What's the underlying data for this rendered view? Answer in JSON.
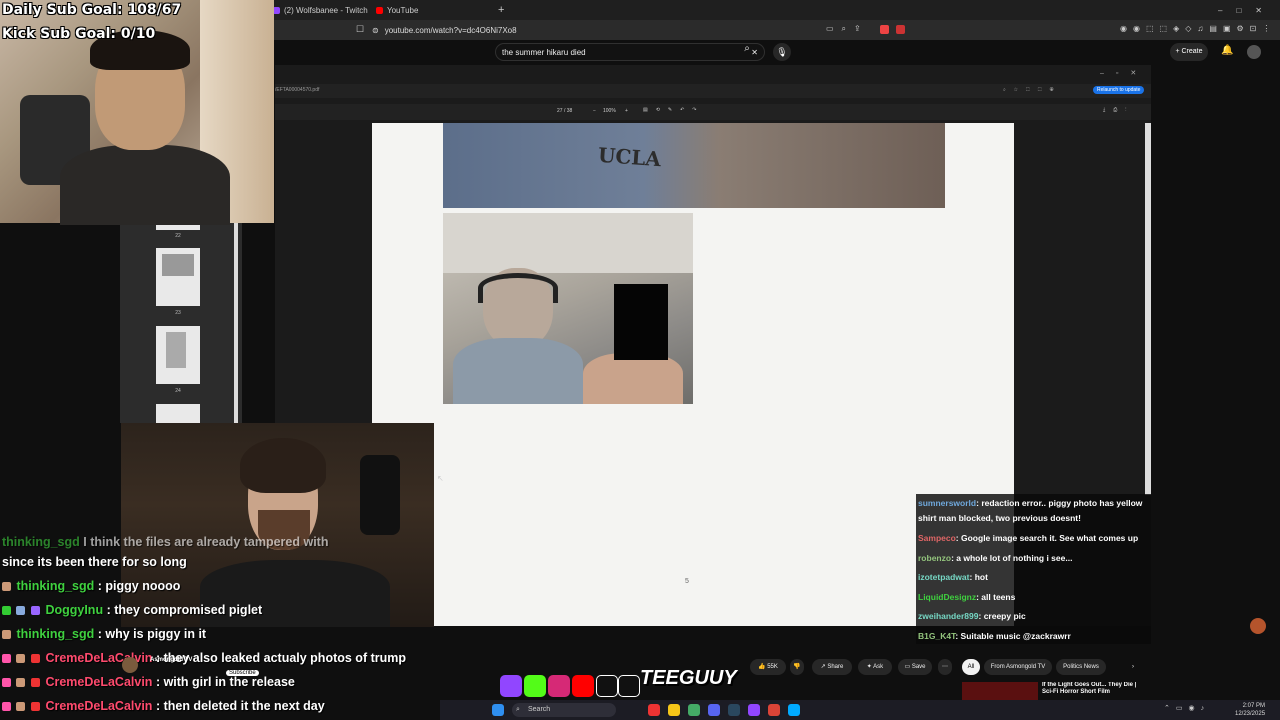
{
  "browser": {
    "tabs": [
      {
        "label": "(2) Wolfsbanee - Twitch",
        "color": "#9146ff"
      },
      {
        "label": "YouTube",
        "color": "#ff0000"
      }
    ],
    "url": "youtube.com/watch?v=dc4O6Ni7Xo8"
  },
  "youtube": {
    "search_value": "the summer hikaru died",
    "create_label": "+ Create"
  },
  "pdf": {
    "filename": "/EFTA00004570.pdf",
    "page_indicator": "27 / 38",
    "zoom": "100%",
    "relaunch_label": "Relaunch to update",
    "photo_text": "UCLA",
    "page_number": "5",
    "thumb_labels": [
      "22",
      "23",
      "24"
    ]
  },
  "overlay": {
    "sub_goal": "Daily Sub Goal: 108/67",
    "kick_goal": "Kick Sub Goal: 0/10"
  },
  "stream_chat": [
    {
      "user": "thinking_sgd",
      "msg": "I think the files are already tampered with",
      "color": "#3fd13f"
    },
    {
      "user": "",
      "msg": "since its been there for so long",
      "color": "#ffffff"
    },
    {
      "user": "thinking_sgd",
      "msg": ": piggy noooo",
      "color": "#3fd13f"
    },
    {
      "user": "DoggyInu",
      "msg": ": they compromised piglet",
      "color": "#3fd13f"
    },
    {
      "user": "thinking_sgd",
      "msg": ": why is piggy in it",
      "color": "#3fd13f"
    },
    {
      "user": "CremeDeLaCalvin",
      "msg": ": they also leaked actualy photos of trump",
      "color": "#ff4b6e"
    },
    {
      "user": "CremeDeLaCalvin",
      "msg": ": with girl in the release",
      "color": "#ff4b6e"
    },
    {
      "user": "CremeDeLaCalvin",
      "msg": ": then deleted it the next day",
      "color": "#ff4b6e"
    }
  ],
  "video_chat": [
    {
      "user": "sumnersworld",
      "msg": "redaction error.. piggy photo has yellow",
      "color": "#6fa8dc"
    },
    {
      "user": "",
      "msg": "shirt man blocked, two previous doesnt!",
      "color": "#ffffff"
    },
    {
      "user": "Sampeco",
      "msg": "Google image search it. See what comes up",
      "color": "#e06666"
    },
    {
      "user": "robenzo",
      "msg": "a whole lot of nothing i see...",
      "color": "#93c47d"
    },
    {
      "user": "izotetpadwat",
      "msg": "hot",
      "color": "#76d7c4"
    },
    {
      "user": "LiquidDesignz",
      "msg": "all teens",
      "color": "#3fd13f"
    },
    {
      "user": "zweihander899",
      "msg": "creepy pic",
      "color": "#76d7c4"
    },
    {
      "user": "B1G_K4T",
      "msg": "Suitable music @zackrawrr",
      "color": "#93c47d"
    }
  ],
  "video_actions": {
    "likes": "55K",
    "share": "Share",
    "ask": "Ask",
    "save": "Save",
    "channel": "Asmongold TV",
    "subscribe": "Subscribe"
  },
  "filters": {
    "all": "All",
    "from": "From Asmongold TV",
    "politics": "Politics News"
  },
  "recommended": {
    "title": "If the Light Goes Out... They Die | Sci-Fi Horror Short Film"
  },
  "taskbar": {
    "search": "Search",
    "time": "2:07 PM",
    "date": "12/23/2025"
  },
  "watermark": "TEEGUUY"
}
